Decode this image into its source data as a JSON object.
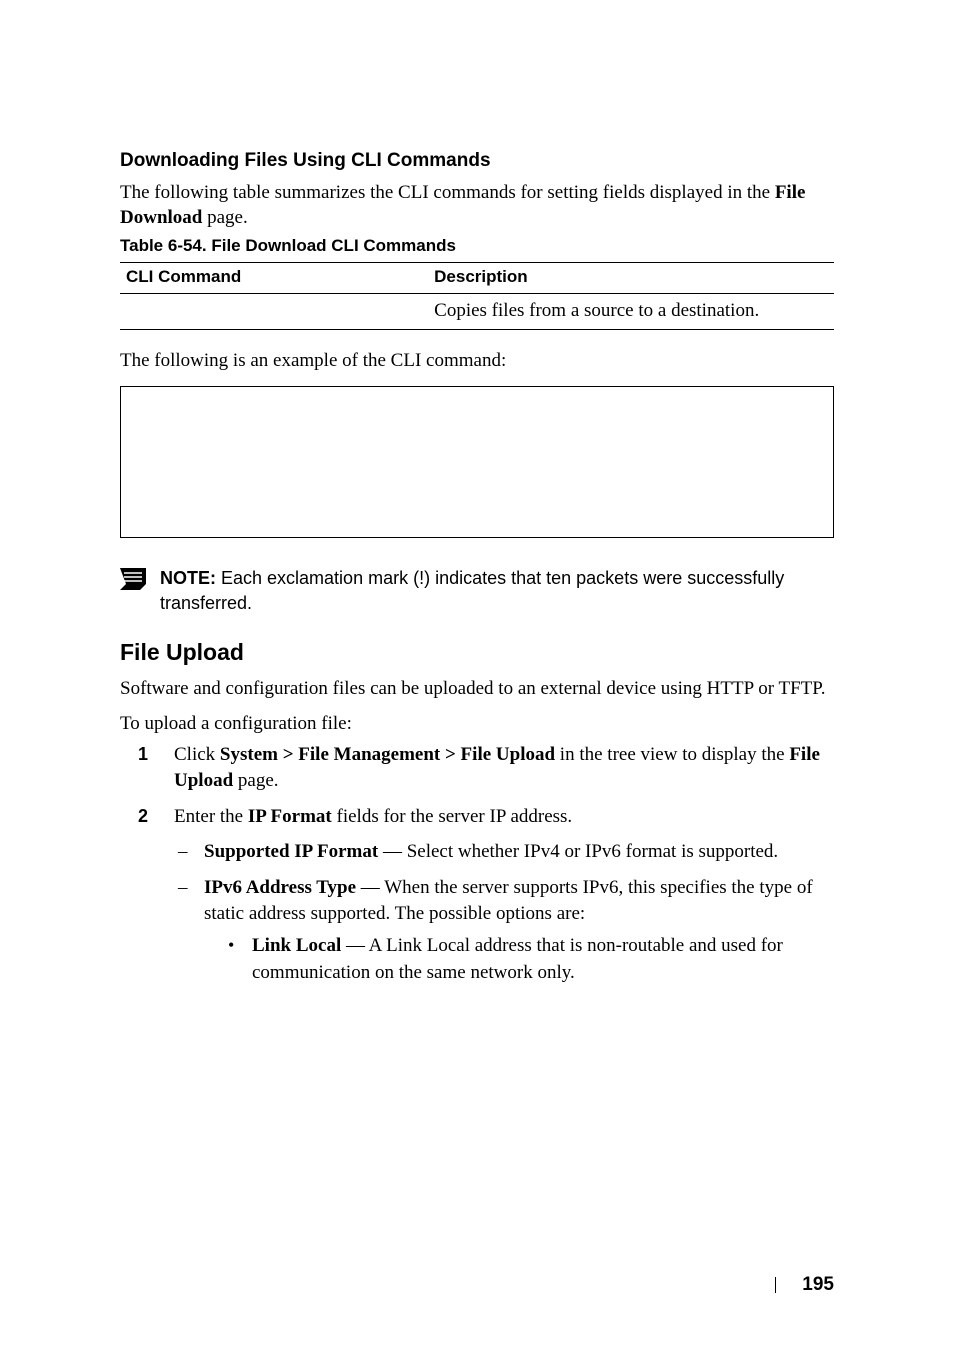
{
  "section": {
    "heading": "Downloading Files Using CLI Commands",
    "intro_1": "The following table summarizes the CLI commands for setting fields displayed in the ",
    "intro_bold": "File Download",
    "intro_2": " page."
  },
  "table": {
    "caption": "Table 6-54.    File Download CLI Commands",
    "headers": {
      "col1": "CLI Command",
      "col2": "Description"
    },
    "row": {
      "cmd": "",
      "desc": "Copies files from a source to a destination."
    }
  },
  "example_lead": "The following is an example of the CLI command:",
  "note": {
    "label": "NOTE:",
    "text": " Each exclamation mark (!) indicates that ten packets were successfully transferred."
  },
  "upload": {
    "heading": "File Upload",
    "para": "Software and configuration files can be uploaded to an external device using HTTP or TFTP.",
    "lead": "To upload a configuration file:",
    "steps": [
      {
        "num": "1",
        "pre": "Click ",
        "bold1": "System > File Management > File Upload",
        "mid": " in the tree view to display the ",
        "bold2": "File Upload",
        "post": " page."
      },
      {
        "num": "2",
        "pre": "Enter the ",
        "bold1": "IP Format",
        "post": " fields for the server IP address.",
        "dashes": [
          {
            "bold": "Supported IP Format",
            "text": " — Select whether IPv4 or IPv6 format is supported."
          },
          {
            "bold": "IPv6 Address Type",
            "text": " — When the server supports IPv6, this specifies the type of static address supported. The possible options are:",
            "bullets": [
              {
                "bold": "Link Local",
                "text": " — A Link Local address that is non-routable and used for communication on the same network only."
              }
            ]
          }
        ]
      }
    ]
  },
  "footer": {
    "page": "195"
  }
}
